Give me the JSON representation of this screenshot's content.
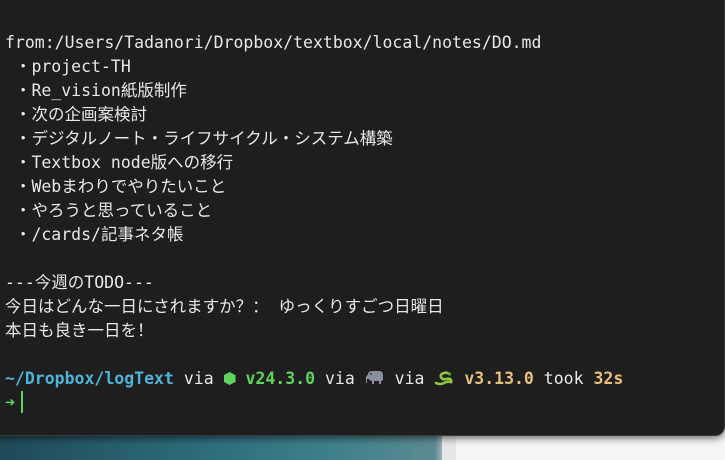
{
  "terminal": {
    "path_line": "from:/Users/Tadanori/Dropbox/textbox/local/notes/DO.md",
    "bullet_char": " ・",
    "items": [
      "project-TH",
      "Re_vision紙版制作",
      "次の企画案検討",
      "デジタルノート・ライフサイクル・システム構築",
      "Textbox node版への移行",
      "Webまわりでやりたいこと",
      "やろうと思っていること",
      "/cards/記事ネタ帳"
    ],
    "todo_header": "---今週のTODO---",
    "question_line": "今日はどんな一日にされますか？： ゆっくりすごつ日曜日",
    "closing_line": "本日も良き一日を！",
    "prompt": {
      "directory": "~/Dropbox/logText",
      "via1": " via ",
      "node_icon": "node-hexagon-icon",
      "node_version": "v24.3.0",
      "via2": " via ",
      "php_icon": "elephant-icon",
      "via3": " via ",
      "python_icon": "snake-icon",
      "python_version": "v3.13.0",
      "took_label": " took ",
      "took_value": "32s",
      "input_arrow": "➜"
    }
  },
  "colors": {
    "directory": "#4fb3d9",
    "node": "#5fd35f",
    "python": "#e5c07b",
    "background": "#1e1e1e"
  }
}
